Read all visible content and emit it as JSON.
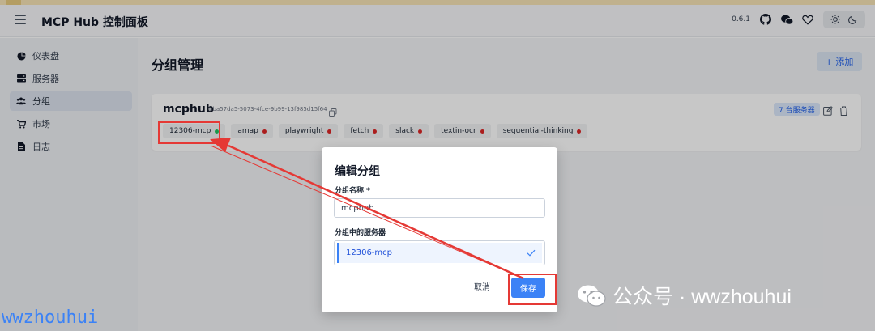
{
  "header": {
    "title": "MCP Hub 控制面板",
    "version": "0.6.1",
    "icons": [
      "menu-icon",
      "github-icon",
      "wechat-icon",
      "heart-icon",
      "sun-icon",
      "moon-icon"
    ]
  },
  "sidebar": {
    "items": [
      {
        "label": "仪表盘",
        "icon": "pie-chart-icon",
        "active": false
      },
      {
        "label": "服务器",
        "icon": "server-icon",
        "active": false
      },
      {
        "label": "分组",
        "icon": "users-icon",
        "active": true
      },
      {
        "label": "市场",
        "icon": "cart-icon",
        "active": false
      },
      {
        "label": "日志",
        "icon": "file-icon",
        "active": false
      }
    ]
  },
  "main": {
    "page_title": "分组管理",
    "add_button": "+ 添加",
    "group": {
      "name": "mcphub",
      "id": "bba57da5-5073-4fce-9b99-13f985d15f64",
      "server_count": "7 台服务器",
      "servers": [
        {
          "name": "12306-mcp",
          "status_color": "#22c55e"
        },
        {
          "name": "amap",
          "status_color": "#dc2626"
        },
        {
          "name": "playwright",
          "status_color": "#dc2626"
        },
        {
          "name": "fetch",
          "status_color": "#dc2626"
        },
        {
          "name": "slack",
          "status_color": "#dc2626"
        },
        {
          "name": "textin-ocr",
          "status_color": "#dc2626"
        },
        {
          "name": "sequential-thinking",
          "status_color": "#dc2626"
        }
      ]
    }
  },
  "modal": {
    "title": "编辑分组",
    "name_label": "分组名称 *",
    "name_value": "mcphub",
    "servers_label": "分组中的服务器",
    "selected_server": "12306-mcp",
    "cancel": "取消",
    "save": "保存"
  },
  "watermarks": {
    "left": "wwzhouhui",
    "right": "公众号 · wwzhouhui"
  },
  "colors": {
    "accent": "#3b82f6",
    "annotation": "#e53935",
    "online": "#22c55e",
    "offline": "#dc2626"
  }
}
